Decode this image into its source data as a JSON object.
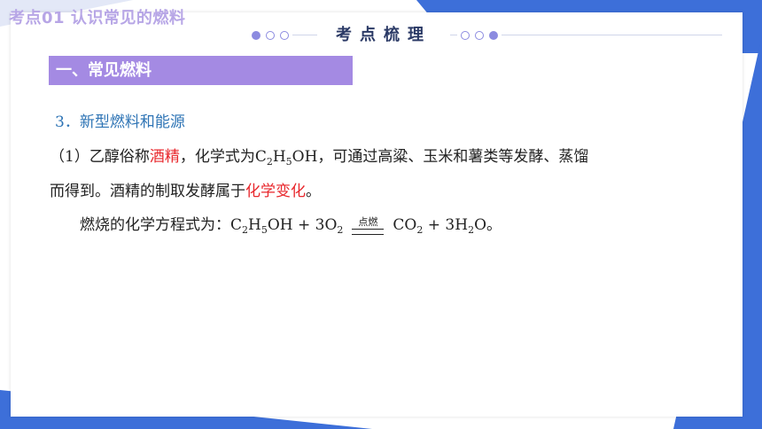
{
  "header": {
    "lesson_title": "考点01  认识常见的燃料",
    "center_title": "考点梳理"
  },
  "section": {
    "heading": "一、常见燃料"
  },
  "content": {
    "subheading": "3．新型燃料和能源",
    "p1_a": "（1）乙醇俗称",
    "p1_red1": "酒精",
    "p1_b": "，化学式为C",
    "p1_sub1": "2",
    "p1_c": "H",
    "p1_sub2": "5",
    "p1_d": "OH，可通过高粱、玉米和薯类等发酵、蒸馏",
    "p2_a": "而得到。酒精的制取发酵属于",
    "p2_red": "化学变化",
    "p2_b": "。",
    "eq_a": "燃烧的化学方程式为：C",
    "eq_s1": "2",
    "eq_b": "H",
    "eq_s2": "5",
    "eq_c": "OH + 3O",
    "eq_s3": "2",
    "eq_condition": "点燃",
    "eq_d": "CO",
    "eq_s4": "2",
    "eq_e": " + 3H",
    "eq_s5": "2",
    "eq_f": "O。"
  },
  "colors": {
    "accent_purple": "#a48ae3",
    "blue_corner": "#3d6fd9",
    "red_text": "#e8262b",
    "subheading_blue": "#2e74b5"
  }
}
